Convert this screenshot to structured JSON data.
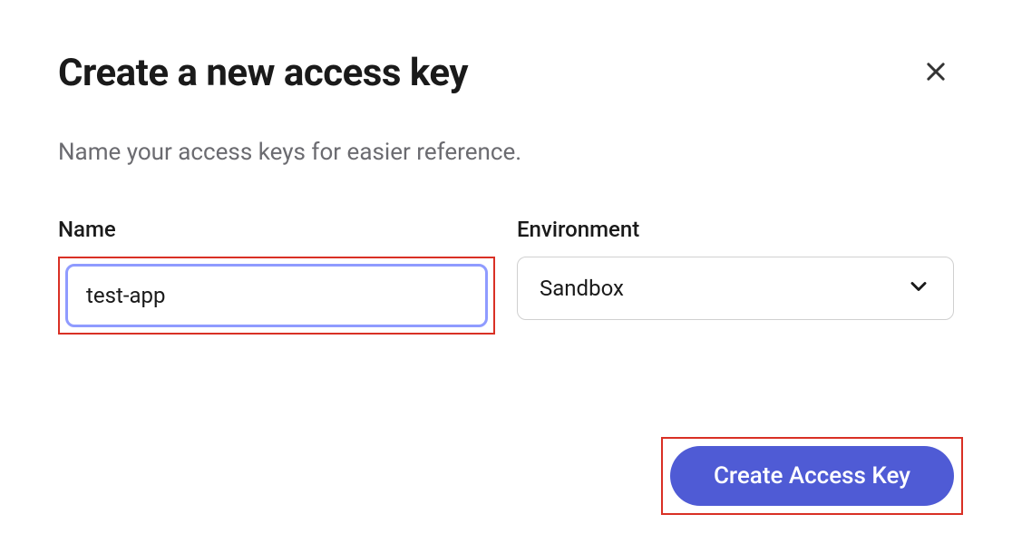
{
  "modal": {
    "title": "Create a new access key",
    "subtitle": "Name your access keys for easier reference.",
    "form": {
      "name": {
        "label": "Name",
        "value": "test-app"
      },
      "environment": {
        "label": "Environment",
        "selected": "Sandbox"
      }
    },
    "actions": {
      "create": "Create Access Key"
    }
  }
}
